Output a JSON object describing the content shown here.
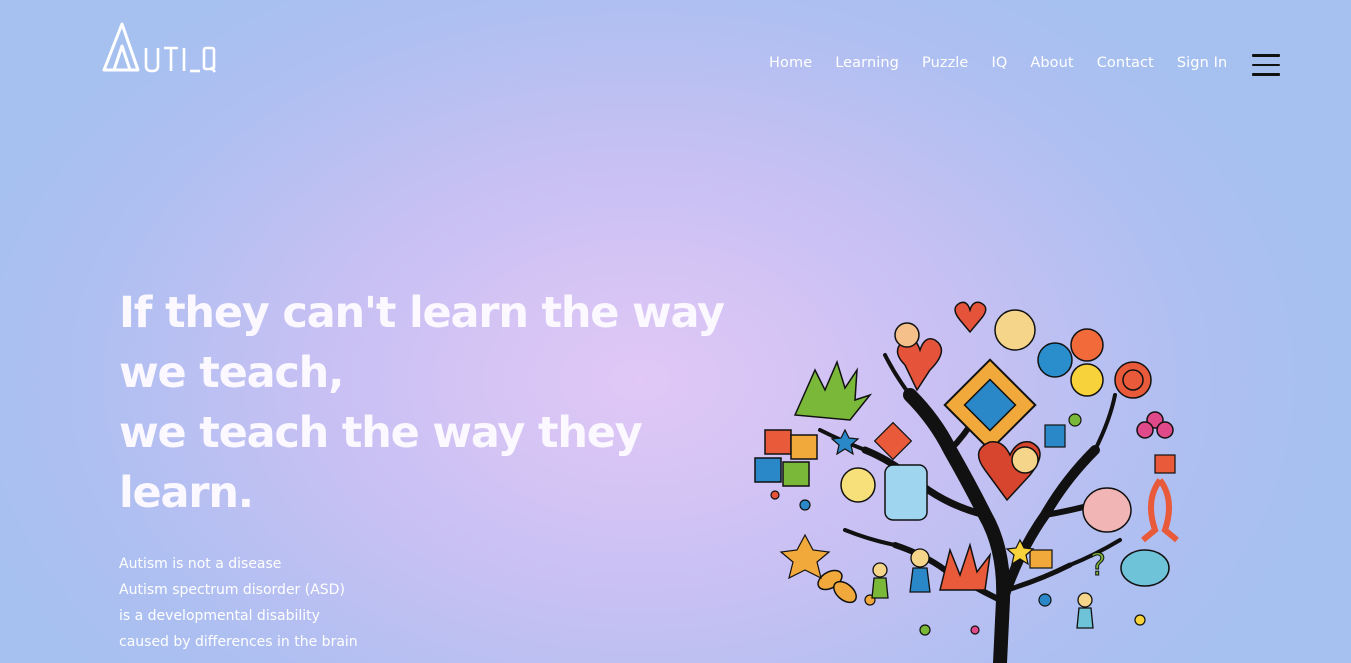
{
  "brand": {
    "logo_text": "AUTI_Q"
  },
  "nav": {
    "items": [
      "Home",
      "Learning",
      "Puzzle",
      "IQ",
      "About",
      "Contact",
      "Sign In"
    ]
  },
  "hero": {
    "title_lines": [
      "If they can't learn the way",
      "we teach,",
      "we teach the way they",
      "learn."
    ],
    "description_lines": [
      "Autism is not a disease",
      "Autism spectrum disorder (ASD)",
      "is a developmental disability",
      "caused by differences in the brain"
    ]
  },
  "illustration": {
    "subject": "puzzle-tree-illustration"
  },
  "colors": {
    "background_center": "#e1c8f6",
    "background_edge": "#a6c0ef",
    "text": "#ffffff"
  }
}
